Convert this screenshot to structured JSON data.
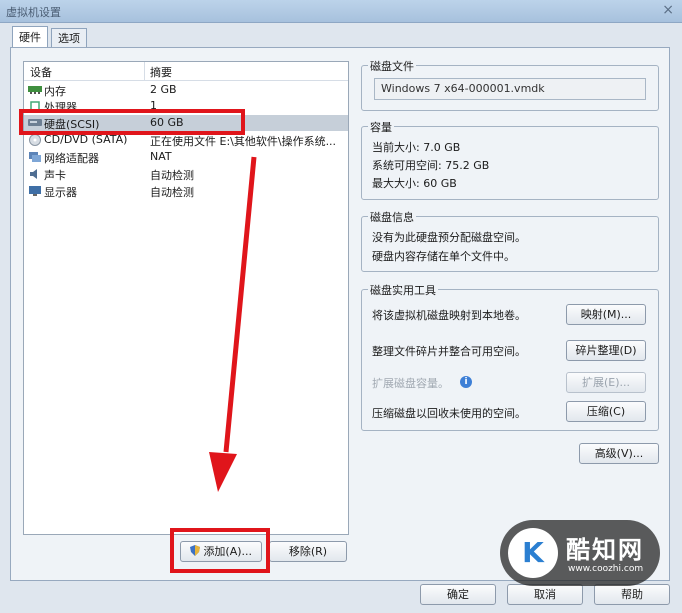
{
  "window": {
    "title": "虚拟机设置",
    "close_glyph": "×"
  },
  "tabs": [
    {
      "label": "硬件"
    },
    {
      "label": "选项"
    }
  ],
  "device_list": {
    "col_device": "设备",
    "col_summary": "摘要",
    "rows": [
      {
        "name": "内存",
        "summary": "2 GB",
        "icon": "memory-icon"
      },
      {
        "name": "处理器",
        "summary": "1",
        "icon": "processor-icon"
      },
      {
        "name": "硬盘(SCSI)",
        "summary": "60 GB",
        "icon": "hard-disk-icon"
      },
      {
        "name": "CD/DVD (SATA)",
        "summary": "正在使用文件 E:\\其他软件\\操作系统...",
        "icon": "cd-dvd-icon"
      },
      {
        "name": "网络适配器",
        "summary": "NAT",
        "icon": "network-adapter-icon"
      },
      {
        "name": "声卡",
        "summary": "自动检测",
        "icon": "sound-card-icon"
      },
      {
        "name": "显示器",
        "summary": "自动检测",
        "icon": "display-icon"
      }
    ]
  },
  "left_buttons": {
    "add": "添加(A)...",
    "remove": "移除(R)"
  },
  "disk_file": {
    "label": "磁盘文件",
    "value": "Windows 7 x64-000001.vmdk"
  },
  "capacity": {
    "label": "容量",
    "current": "当前大小: 7.0 GB",
    "available": "系统可用空间: 75.2 GB",
    "max": "最大大小: 60 GB"
  },
  "disk_info": {
    "label": "磁盘信息",
    "line1": "没有为此硬盘预分配磁盘空间。",
    "line2": "硬盘内容存储在单个文件中。"
  },
  "utilities": {
    "label": "磁盘实用工具",
    "map_text": "将该虚拟机磁盘映射到本地卷。",
    "map_btn": "映射(M)...",
    "defrag_text": "整理文件碎片并整合可用空间。",
    "defrag_btn": "碎片整理(D)",
    "expand_text": "扩展磁盘容量。",
    "expand_btn": "扩展(E)...",
    "compact_text": "压缩磁盘以回收未使用的空间。",
    "compact_btn": "压缩(C)"
  },
  "advanced_btn": "高级(V)...",
  "footer": {
    "ok": "确定",
    "cancel": "取消",
    "help": "帮助"
  },
  "watermark": {
    "brand": "酷知网",
    "url": "www.coozhi.com",
    "logo": "K"
  },
  "colors": {
    "annotation_red": "#e0151b",
    "selection": "#c6cfd9",
    "accent": "#3d7fd6"
  }
}
